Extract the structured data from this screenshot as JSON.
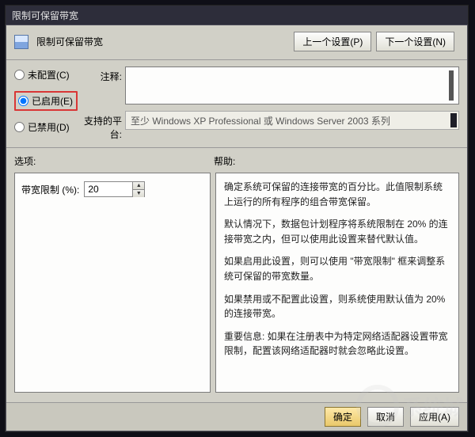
{
  "window": {
    "title": "限制可保留带宽"
  },
  "header": {
    "subtitle": "限制可保留带宽",
    "prev_button": "上一个设置(P)",
    "next_button": "下一个设置(N)"
  },
  "radios": {
    "not_configured": "未配置(C)",
    "enabled": "已启用(E)",
    "disabled": "已禁用(D)"
  },
  "fields": {
    "comment_label": "注释:",
    "comment_value": "",
    "platform_label": "支持的平台:",
    "platform_value": "至少 Windows XP Professional 或 Windows Server 2003 系列"
  },
  "section_labels": {
    "options": "选项:",
    "help": "帮助:"
  },
  "options": {
    "bandwidth_label": "带宽限制 (%):",
    "bandwidth_value": "20"
  },
  "help": {
    "p1": "确定系统可保留的连接带宽的百分比。此值限制系统上运行的所有程序的组合带宽保留。",
    "p2": "默认情况下，数据包计划程序将系统限制在 20% 的连接带宽之内，但可以使用此设置来替代默认值。",
    "p3": "如果启用此设置，则可以使用 \"带宽限制\" 框来调整系统可保留的带宽数量。",
    "p4": "如果禁用或不配置此设置，则系统使用默认值为 20% 的连接带宽。",
    "p5": "重要信息: 如果在注册表中为特定网络适配器设置带宽限制，配置该网络适配器时就会忽略此设置。"
  },
  "buttons": {
    "ok": "确定",
    "cancel": "取消",
    "apply": "应用(A)"
  },
  "watermark": {
    "text": "系统城"
  }
}
